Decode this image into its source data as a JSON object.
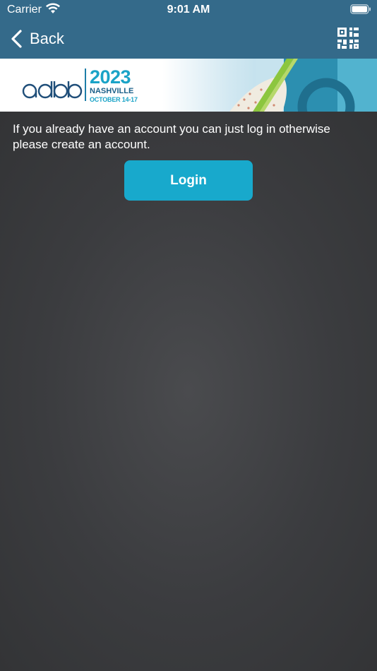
{
  "status_bar": {
    "carrier": "Carrier",
    "time": "9:01 AM"
  },
  "nav": {
    "back_label": "Back",
    "qr_icon": "qr-code-icon"
  },
  "banner": {
    "logo_text": "adbb",
    "year": "2023",
    "city": "NASHVILLE",
    "dates": "OCTOBER 14-17"
  },
  "content": {
    "message": "If you already have an account you can just log in otherwise please create an account.",
    "login_label": "Login"
  },
  "colors": {
    "nav_background": "#346a8a",
    "button": "#18a9cc",
    "content_background": "#3a3b3d"
  }
}
